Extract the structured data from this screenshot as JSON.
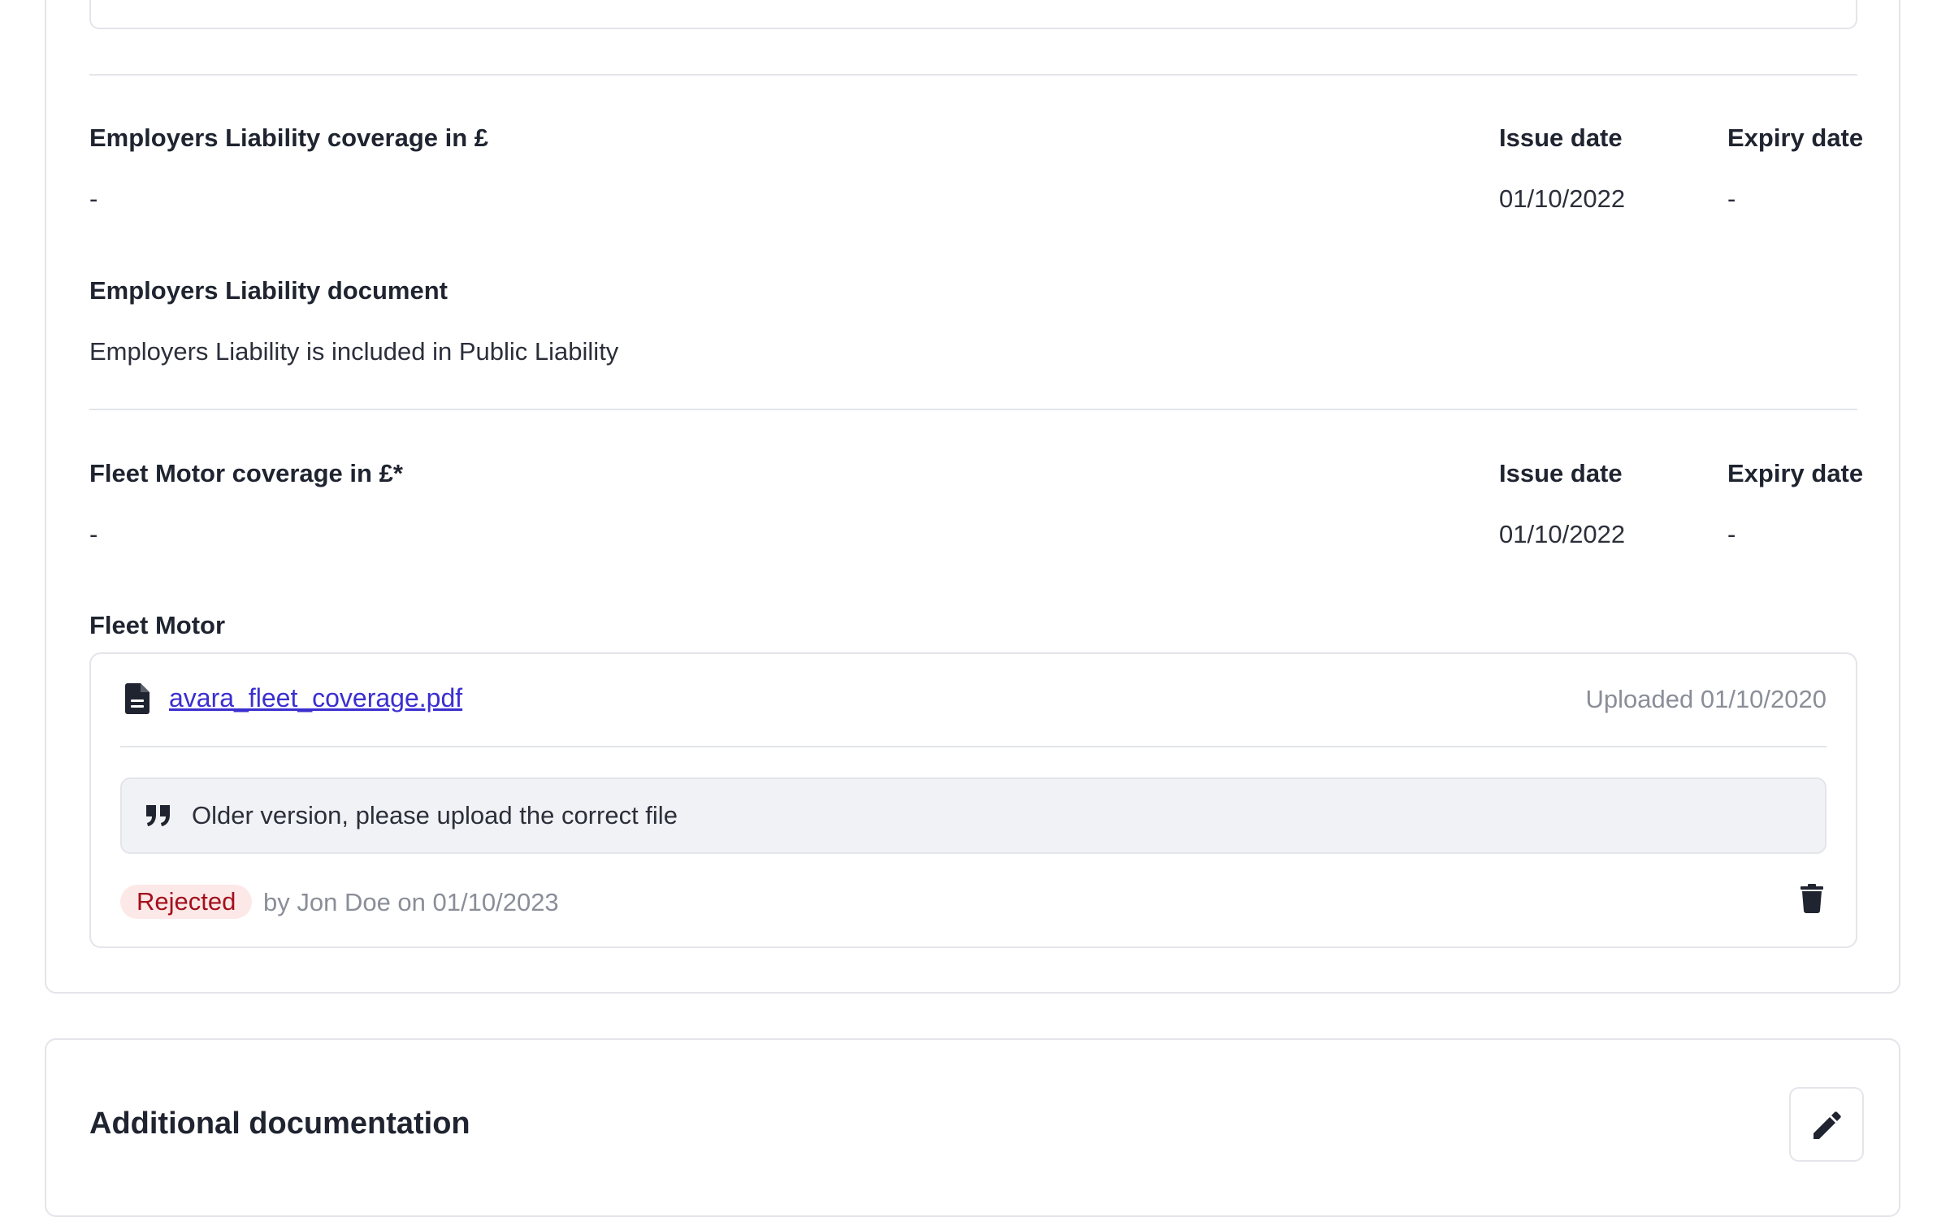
{
  "employers_liability": {
    "coverage_label": "Employers Liability coverage in £",
    "coverage_value": "-",
    "issue_label": "Issue date",
    "issue_value": "01/10/2022",
    "expiry_label": "Expiry date",
    "expiry_value": "-",
    "document_label": "Employers Liability document",
    "document_value": "Employers Liability is included in Public Liability"
  },
  "fleet_motor": {
    "coverage_label": "Fleet Motor coverage in £*",
    "coverage_value": "-",
    "issue_label": "Issue date",
    "issue_value": "01/10/2022",
    "expiry_label": "Expiry date",
    "expiry_value": "-",
    "document_label": "Fleet Motor",
    "file": {
      "name": "avara_fleet_coverage.pdf",
      "uploaded": "Uploaded 01/10/2020",
      "comment": "Older version, please upload the correct file",
      "status": "Rejected",
      "status_by": "by Jon Doe on 01/10/2023"
    }
  },
  "additional": {
    "title": "Additional documentation"
  },
  "icons": {
    "file": "file-icon",
    "quote": "quote-icon",
    "trash": "trash-icon",
    "edit": "pencil-icon"
  },
  "colors": {
    "link": "#3b2fd0",
    "rejected_bg": "#fde8e8",
    "rejected_text": "#a3101c",
    "border": "#e3e5ea"
  }
}
